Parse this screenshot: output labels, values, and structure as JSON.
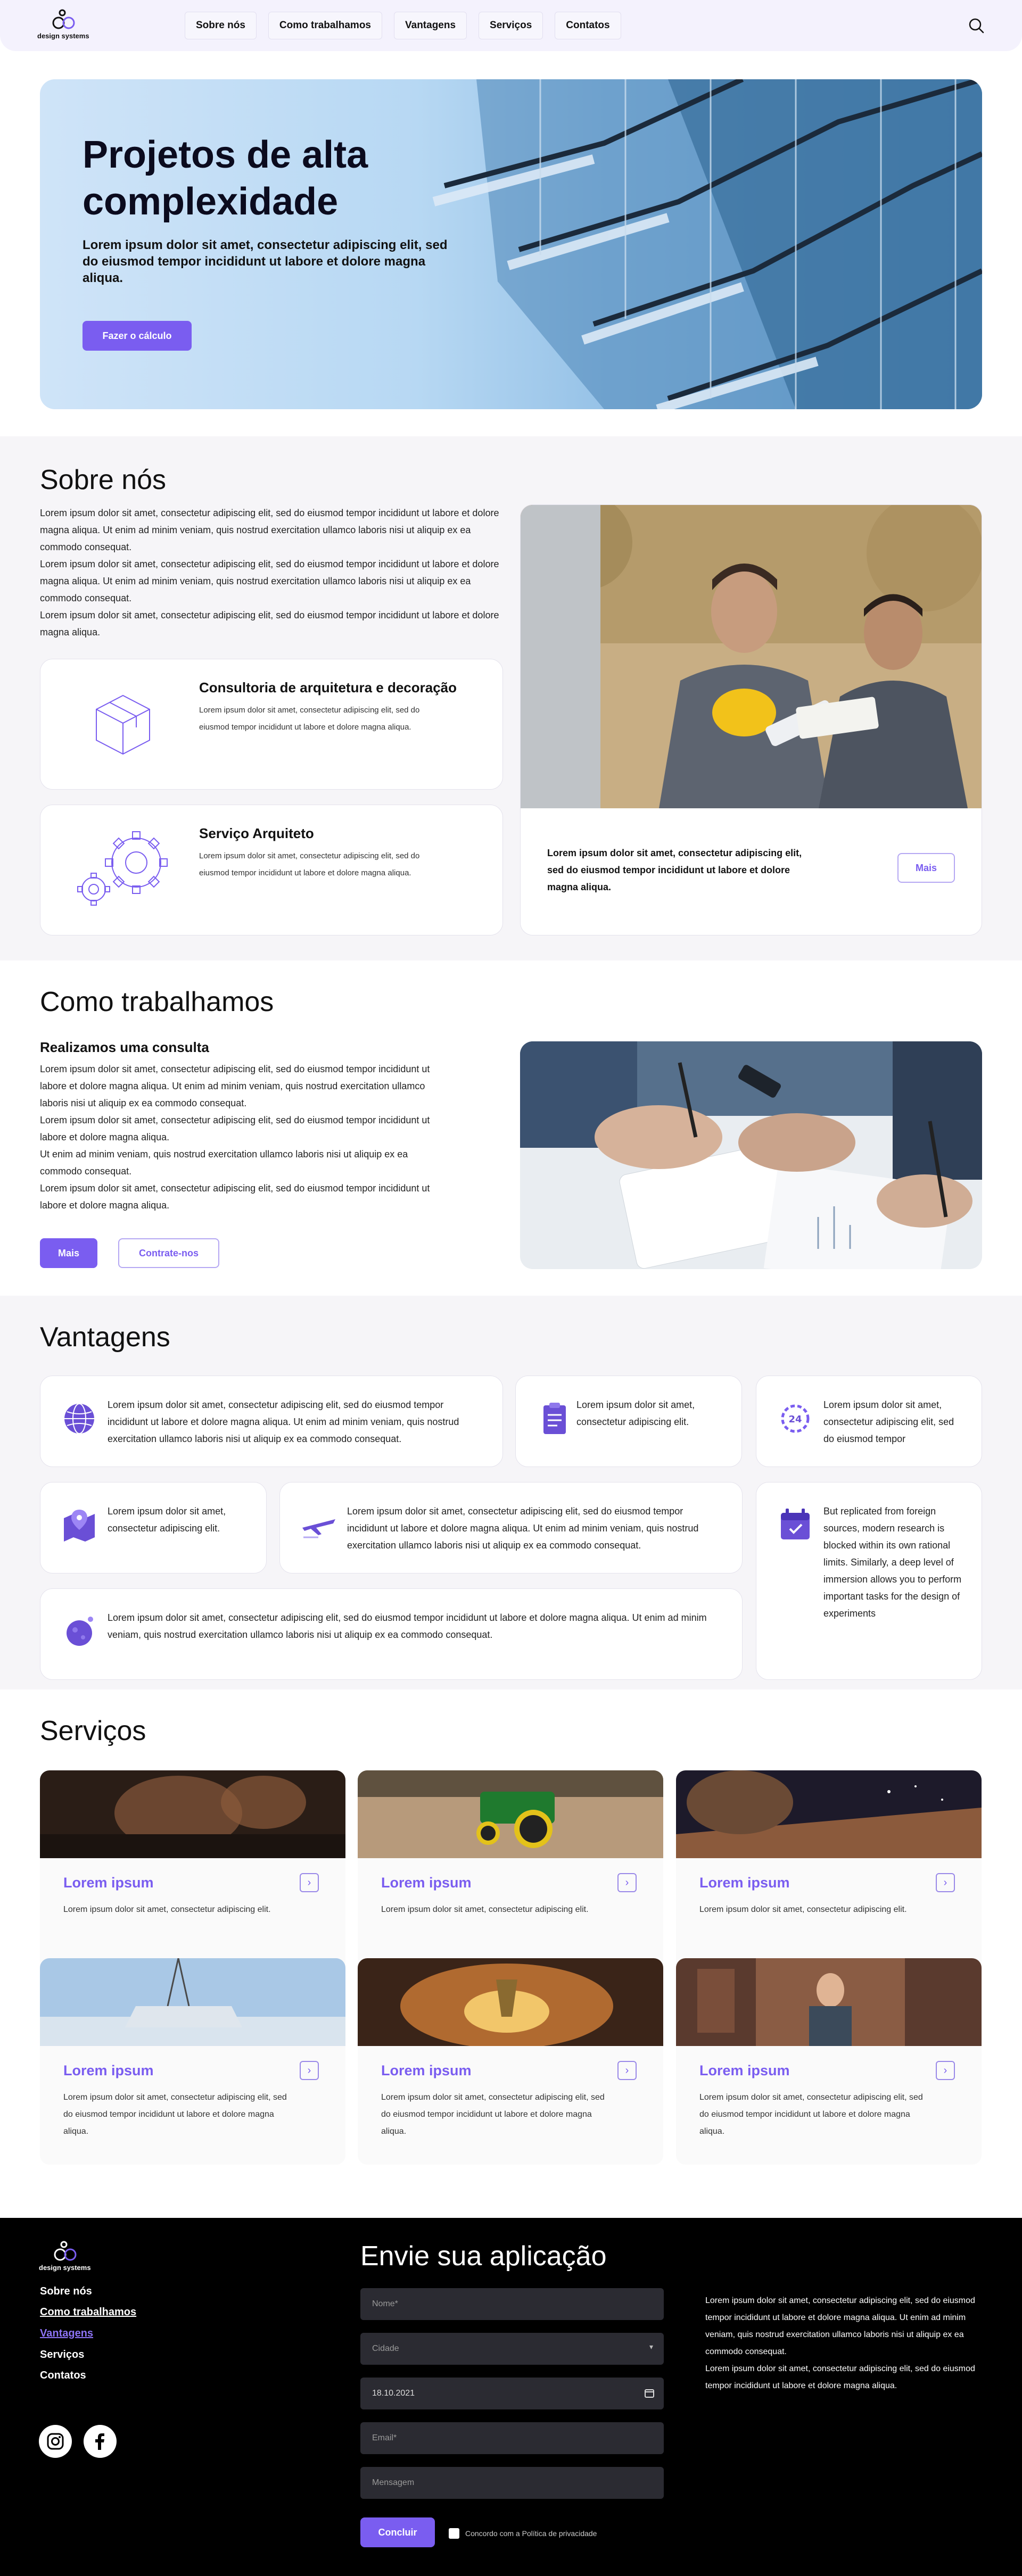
{
  "brand": {
    "name": "design systems",
    "accent": "#7a5df0"
  },
  "nav": {
    "items": [
      "Sobre nós",
      "Como trabalhamos",
      "Vantagens",
      "Serviços",
      "Contatos"
    ],
    "search_icon": "search-icon"
  },
  "hero": {
    "title": "Projetos de alta complexidade",
    "subtitle": "Lorem ipsum dolor sit amet, consectetur adipiscing elit, sed do eiusmod tempor incididunt ut labore et dolore magna aliqua.",
    "cta": "Fazer o cálculo"
  },
  "about": {
    "title": "Sobre nós",
    "text": "Lorem ipsum dolor sit amet, consectetur adipiscing elit, sed do eiusmod tempor incididunt ut labore et dolore magna aliqua. Ut enim ad minim veniam, quis nostrud exercitation ullamco laboris nisi ut aliquip ex ea commodo consequat.\nLorem ipsum dolor sit amet, consectetur adipiscing elit, sed do eiusmod tempor incididunt ut labore et dolore magna aliqua. Ut enim ad minim veniam, quis nostrud exercitation ullamco laboris nisi ut aliquip ex ea commodo consequat.\nLorem ipsum dolor sit amet, consectetur adipiscing elit, sed do eiusmod tempor incididunt ut labore et dolore magna aliqua.",
    "cards": [
      {
        "title": "Consultoria de arquitetura e decoração",
        "text": "Lorem ipsum dolor sit amet, consectetur adipiscing elit, sed do eiusmod tempor incididunt ut labore et dolore magna aliqua.",
        "icon": "cube-icon"
      },
      {
        "title": "Serviço Arquiteto",
        "text": "Lorem ipsum dolor sit amet, consectetur adipiscing elit, sed do eiusmod tempor incididunt ut labore et dolore magna aliqua.",
        "icon": "gears-icon"
      }
    ],
    "photo_caption": "Lorem ipsum dolor sit amet, consectetur adipiscing elit, sed do eiusmod tempor incididunt ut labore et dolore magna aliqua.",
    "more": "Mais"
  },
  "how": {
    "title": "Como trabalhamos",
    "subtitle": "Realizamos uma consulta",
    "text": "Lorem ipsum dolor sit amet, consectetur adipiscing elit, sed do eiusmod tempor incididunt ut labore et dolore magna aliqua. Ut enim ad minim veniam, quis nostrud exercitation ullamco laboris nisi ut aliquip ex ea commodo consequat.\nLorem ipsum dolor sit amet, consectetur adipiscing elit, sed do eiusmod tempor incididunt ut labore et dolore magna aliqua.\nUt enim ad minim veniam, quis nostrud exercitation ullamco laboris nisi ut aliquip ex ea commodo consequat.\nLorem ipsum dolor sit amet, consectetur adipiscing elit, sed do eiusmod tempor incididunt ut labore et dolore magna aliqua.",
    "more": "Mais",
    "hire": "Contrate-nos"
  },
  "advantages": {
    "title": "Vantagens",
    "items": [
      {
        "icon": "globe-icon",
        "text": "Lorem ipsum dolor sit amet, consectetur adipiscing elit, sed do eiusmod tempor incididunt ut labore et dolore magna aliqua. Ut enim ad minim veniam, quis nostrud exercitation ullamco laboris nisi ut aliquip ex ea commodo consequat."
      },
      {
        "icon": "clipboard-icon",
        "text": "Lorem ipsum dolor sit amet, consectetur adipiscing elit."
      },
      {
        "icon": "clock-24-icon",
        "text": "Lorem ipsum dolor sit amet, consectetur adipiscing elit, sed do eiusmod tempor"
      },
      {
        "icon": "map-pin-icon",
        "text": "Lorem ipsum dolor sit amet, consectetur adipiscing elit."
      },
      {
        "icon": "airplane-icon",
        "text": "Lorem ipsum dolor sit amet, consectetur adipiscing elit, sed do eiusmod tempor incididunt ut labore et dolore magna aliqua. Ut enim ad minim veniam, quis nostrud exercitation ullamco laboris nisi ut aliquip ex ea commodo consequat."
      },
      {
        "icon": "calendar-icon",
        "text": "But replicated from foreign sources, modern research is blocked within its own rational limits. Similarly, a deep level of immersion allows you to perform important tasks for the design of experiments"
      },
      {
        "icon": "planet-icon",
        "text": "Lorem ipsum dolor sit amet, consectetur adipiscing elit, sed do eiusmod tempor incididunt ut labore et dolore magna aliqua. Ut enim ad minim veniam, quis nostrud exercitation ullamco laboris nisi ut aliquip ex ea commodo consequat."
      }
    ]
  },
  "services": {
    "title": "Serviços",
    "items": [
      {
        "title": "Lorem ipsum",
        "text": "Lorem ipsum dolor sit amet, consectetur adipiscing elit."
      },
      {
        "title": "Lorem ipsum",
        "text": "Lorem ipsum dolor sit amet, consectetur adipiscing elit."
      },
      {
        "title": "Lorem ipsum",
        "text": "Lorem ipsum dolor sit amet, consectetur adipiscing elit."
      },
      {
        "title": "Lorem ipsum",
        "text": "Lorem ipsum dolor sit amet, consectetur adipiscing elit, sed do eiusmod tempor incididunt ut labore et dolore magna aliqua."
      },
      {
        "title": "Lorem ipsum",
        "text": "Lorem ipsum dolor sit amet, consectetur adipiscing elit, sed do eiusmod tempor incididunt ut labore et dolore magna aliqua."
      },
      {
        "title": "Lorem ipsum",
        "text": "Lorem ipsum dolor sit amet, consectetur adipiscing elit, sed do eiusmod tempor incididunt ut labore et dolore magna aliqua."
      }
    ]
  },
  "footer": {
    "links": [
      "Sobre nós",
      "Como trabalhamos",
      "Vantagens",
      "Serviços",
      "Contatos"
    ],
    "form_title": "Envie sua aplicação",
    "name_placeholder": "Nome*",
    "city_placeholder": "Cidade",
    "date_value": "18.10.2021",
    "email_placeholder": "Email*",
    "message_placeholder": "Mensagem",
    "submit": "Concluir",
    "consent": "Concordo com a Política de privacidade",
    "text": "Lorem ipsum dolor sit amet, consectetur adipiscing elit, sed do eiusmod tempor incididunt ut labore et dolore magna aliqua. Ut enim ad minim veniam, quis nostrud exercitation ullamco laboris nisi ut aliquip ex ea commodo consequat.\nLorem ipsum dolor sit amet, consectetur adipiscing elit, sed do eiusmod tempor incididunt ut labore et dolore magna aliqua.",
    "social": [
      "instagram-icon",
      "facebook-icon"
    ]
  }
}
